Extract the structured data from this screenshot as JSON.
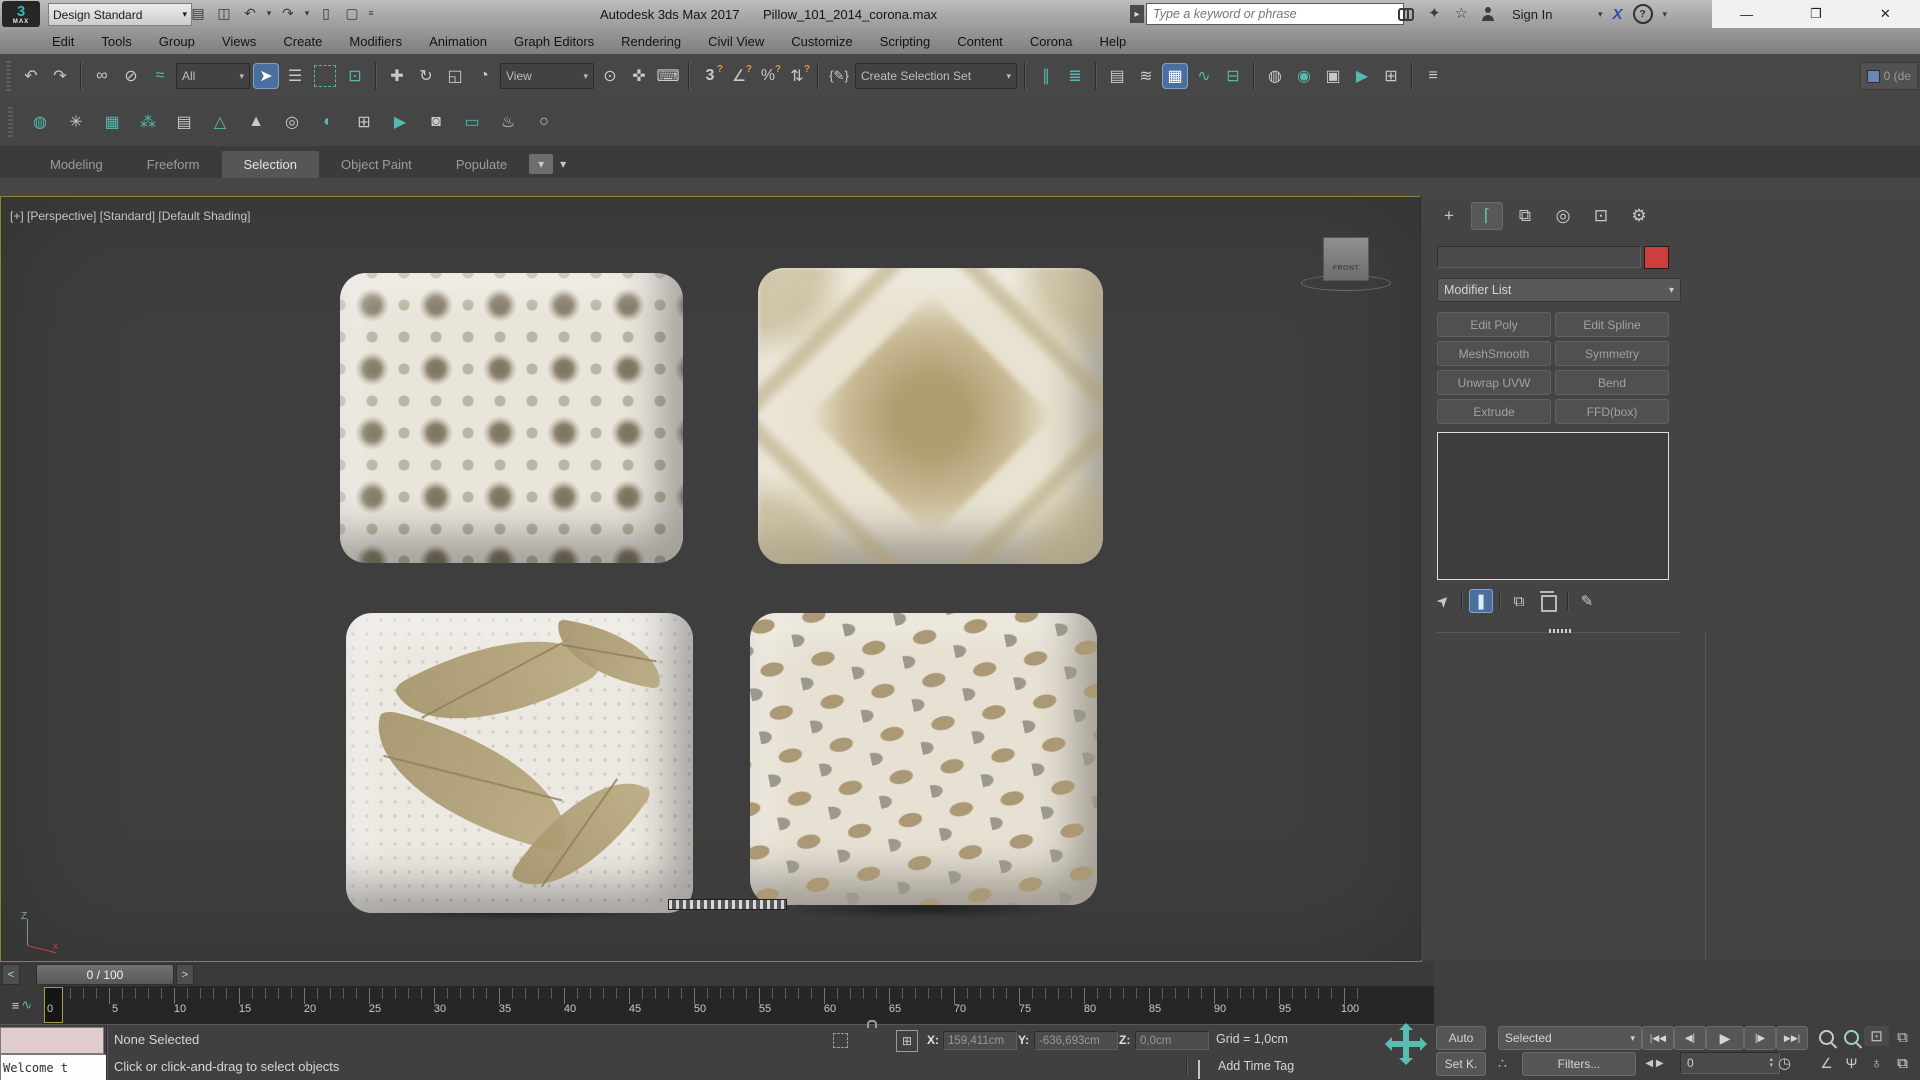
{
  "titlebar": {
    "logo_top": "3",
    "logo_bottom": "MAX",
    "workspace": "Design Standard",
    "app_title": "Autodesk 3ds Max 2017",
    "document": "Pillow_101_2014_corona.max",
    "search_placeholder": "Type a keyword or phrase",
    "sign_in": "Sign In"
  },
  "menubar": {
    "items": [
      "Edit",
      "Tools",
      "Group",
      "Views",
      "Create",
      "Modifiers",
      "Animation",
      "Graph Editors",
      "Rendering",
      "Civil View",
      "Customize",
      "Scripting",
      "Content",
      "Corona",
      "Help"
    ]
  },
  "toolbar": {
    "selection_filter": "All",
    "coord_system": "View",
    "named_sets": "Create Selection Set",
    "layer_indicator": "0 (de"
  },
  "ribbon": {
    "tabs": [
      "Modeling",
      "Freeform",
      "Selection",
      "Object Paint",
      "Populate"
    ],
    "active": "Selection"
  },
  "viewport": {
    "label": "[+] [Perspective] [Standard] [Default Shading]",
    "viewcube_face": "FRONT"
  },
  "panel": {
    "modifier_list": "Modifier List",
    "buttons": [
      "Edit Poly",
      "Edit Spline",
      "MeshSmooth",
      "Symmetry",
      "Unwrap UVW",
      "Bend",
      "Extrude",
      "FFD(box)"
    ]
  },
  "timeline": {
    "frame_display": "0 / 100",
    "prev": "<",
    "next": ">",
    "ticks": [
      "0",
      "5",
      "10",
      "15",
      "20",
      "25",
      "30",
      "35",
      "40",
      "45",
      "50",
      "55",
      "60",
      "65",
      "70",
      "75",
      "80",
      "85",
      "90",
      "95",
      "100"
    ]
  },
  "status": {
    "listener_text": "Welcome t",
    "selection_status": "None Selected",
    "prompt": "Click or click-and-drag to select objects",
    "x_label": "X:",
    "x_value": "159,411cm",
    "y_label": "Y:",
    "y_value": "-636,693cm",
    "z_label": "Z:",
    "z_value": "0,0cm",
    "grid": "Grid = 1,0cm",
    "add_time_tag": "Add Time Tag"
  },
  "anim": {
    "auto": "Auto",
    "set_key": "Set K.",
    "key_filter": "Selected",
    "filters": "Filters...",
    "frame": "0"
  },
  "icons": {
    "caret": "▾",
    "open": "▤",
    "save": "◫",
    "undo": "↶",
    "redo": "↷",
    "fetch": "▯",
    "newdoc": "▢",
    "overflow": "≡",
    "search_go": "▸",
    "satellite": "✦",
    "star": "☆",
    "exchange": "X",
    "help": "?",
    "minimize": "—",
    "restore": "❐",
    "close": "✕",
    "link": "∞",
    "unlink": "⊘",
    "bind": "≈",
    "cursor": "➤",
    "byname": "☰",
    "region": "▢",
    "wincross": "⊡",
    "move": "✚",
    "rotate": "↻",
    "scale": "◱",
    "place": "◔",
    "pivot": "⊙",
    "manipulate": "✜",
    "kbd": "⌨",
    "snap3": "3",
    "snapang": "∠",
    "snappct": "%",
    "snapspin": "⇅",
    "maxscript": "{✎}",
    "mirror": "∥",
    "align": "≣",
    "layermgr": "▤",
    "sceneexp": "≋",
    "ribbon": "▦",
    "curve": "∿",
    "schematic": "⊟",
    "mtled": "◍",
    "rsetup": "◉",
    "rframe": "▣",
    "render": "▶",
    "gallery": "⊞",
    "layers": "≡",
    "corona": [
      "◍",
      "✳",
      "▦",
      "⁂",
      "▤",
      "△",
      "▲",
      "◎",
      "◐",
      "⊞",
      "▶",
      "◙",
      "▭",
      "♨",
      "○"
    ],
    "create": "+",
    "modify": "⌈",
    "hierarchy": "⧉",
    "motion": "◎",
    "display": "⊡",
    "utilities": "⚙",
    "pin": "➤",
    "end_result": "❚",
    "make_unique": "⧉",
    "configure": "✎",
    "curve_mini_a": "≡",
    "curve_mini_b": "∿",
    "absrel": "⊞",
    "to_start": "|◀◀",
    "prev_frame": "◀|",
    "play": "▶",
    "next_frame": "|▶",
    "to_end": "▶▶|",
    "key_step": "◀ ▶",
    "spin_up": "▴",
    "spin_dn": "▾",
    "time_config": "◷",
    "key_filter_glyph": "∴",
    "fov": "∠",
    "pan": "Ψ",
    "orbit": "♁",
    "max_viewport": "⧉"
  },
  "colors": {
    "accent_teal": "#55b7ae",
    "selection_blue": "#4a6f9e",
    "swatch_red": "#cf3e3e",
    "viewport_border": "#8f8033",
    "marker_yellow": "#ad9e3c",
    "listener_pink": "#e2cdcd"
  }
}
